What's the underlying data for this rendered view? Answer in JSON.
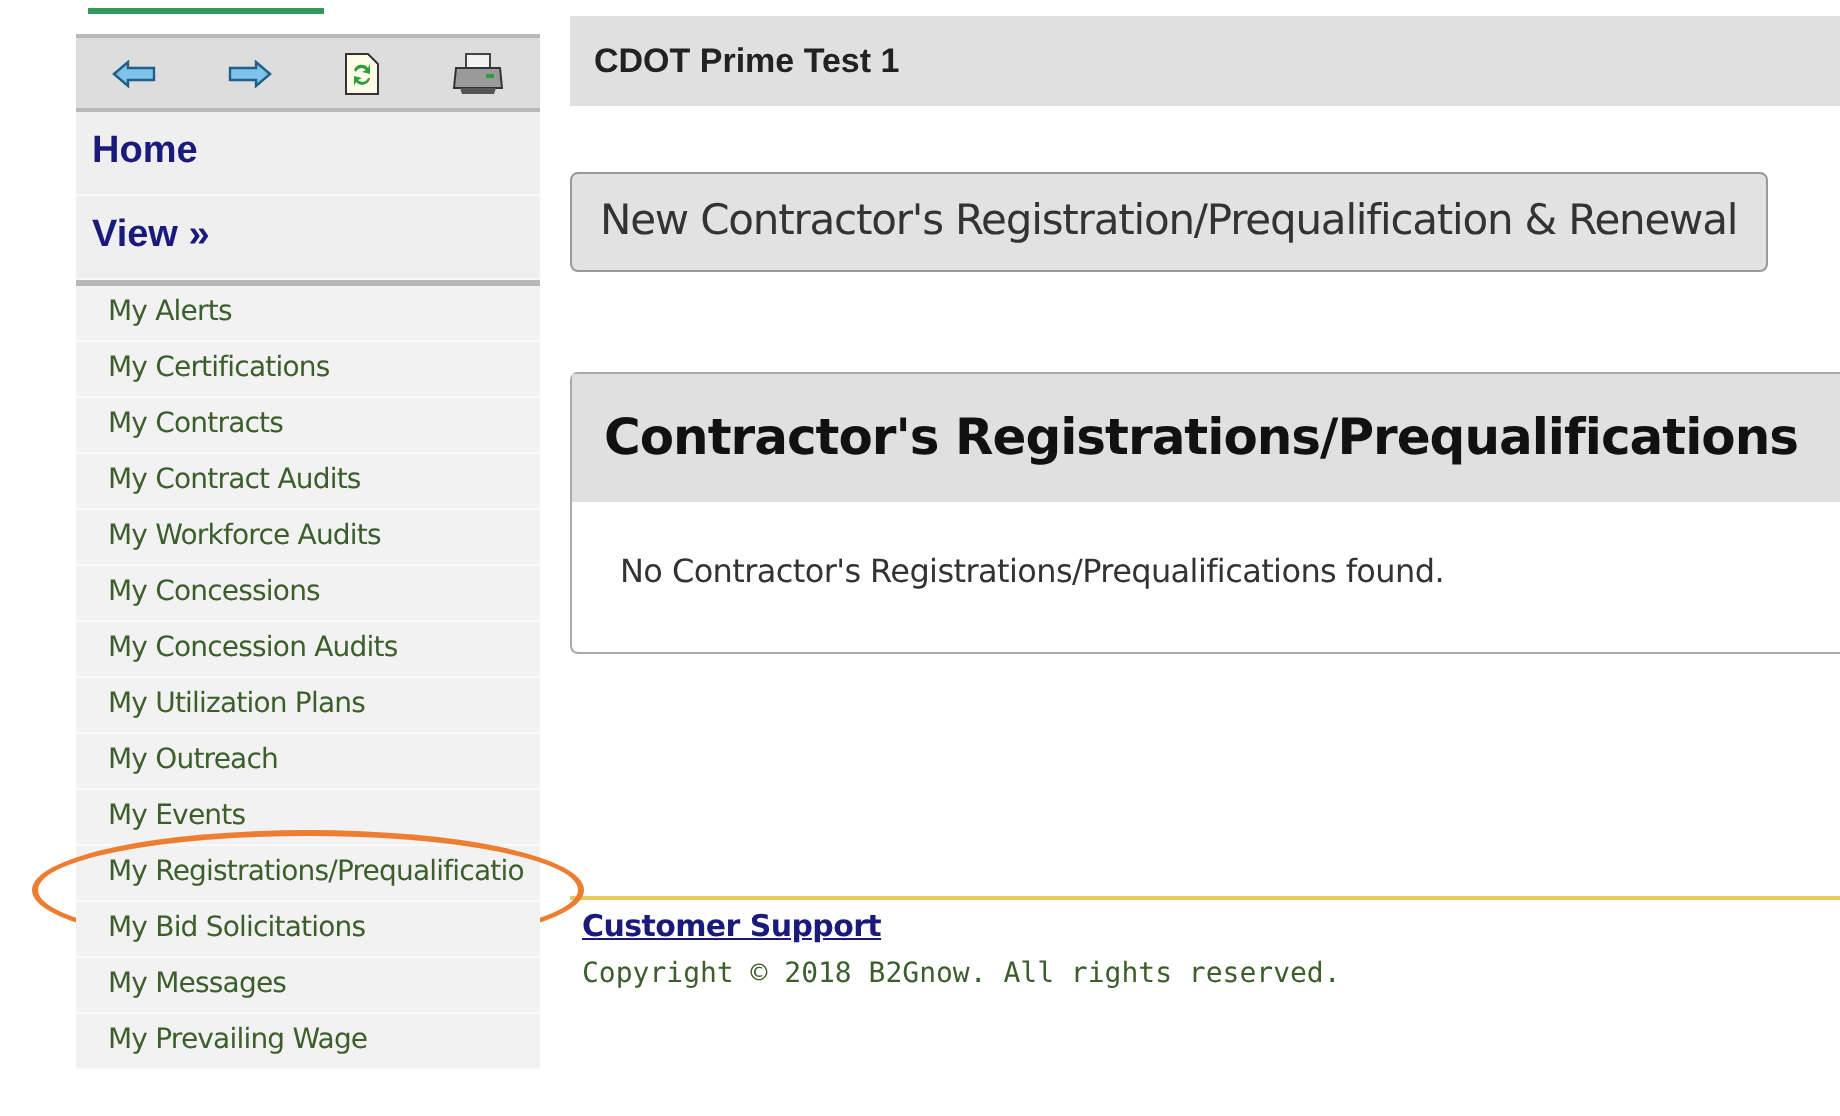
{
  "toolbar": {
    "buttons": [
      {
        "kind": "back"
      },
      {
        "kind": "forward"
      },
      {
        "kind": "refresh"
      },
      {
        "kind": "print"
      }
    ]
  },
  "sidebar": {
    "sections": [
      "Home",
      "View »"
    ],
    "items": [
      {
        "label": "My Alerts",
        "highlighted": false
      },
      {
        "label": "My Certifications",
        "highlighted": false
      },
      {
        "label": "My Contracts",
        "highlighted": false
      },
      {
        "label": "My Contract Audits",
        "highlighted": false
      },
      {
        "label": "My Workforce Audits",
        "highlighted": false
      },
      {
        "label": "My Concessions",
        "highlighted": false
      },
      {
        "label": "My Concession Audits",
        "highlighted": false
      },
      {
        "label": "My Utilization Plans",
        "highlighted": false
      },
      {
        "label": "My Outreach",
        "highlighted": false
      },
      {
        "label": "My Events",
        "highlighted": false
      },
      {
        "label": "My Registrations/Prequalificatio",
        "highlighted": true
      },
      {
        "label": "My Bid Solicitations",
        "highlighted": false
      },
      {
        "label": "My Messages",
        "highlighted": false
      },
      {
        "label": "My Prevailing Wage",
        "highlighted": false
      }
    ]
  },
  "header": {
    "title": "CDOT Prime Test 1"
  },
  "new_button": "New Contractor's Registration/Prequalification & Renewal",
  "panel": {
    "title": "Contractor's Registrations/Prequalifications",
    "empty_message": "No Contractor's Registrations/Prequalifications found."
  },
  "footer": {
    "link": "Customer Support",
    "copyright": "Copyright © 2018 B2Gnow. All rights reserved."
  }
}
